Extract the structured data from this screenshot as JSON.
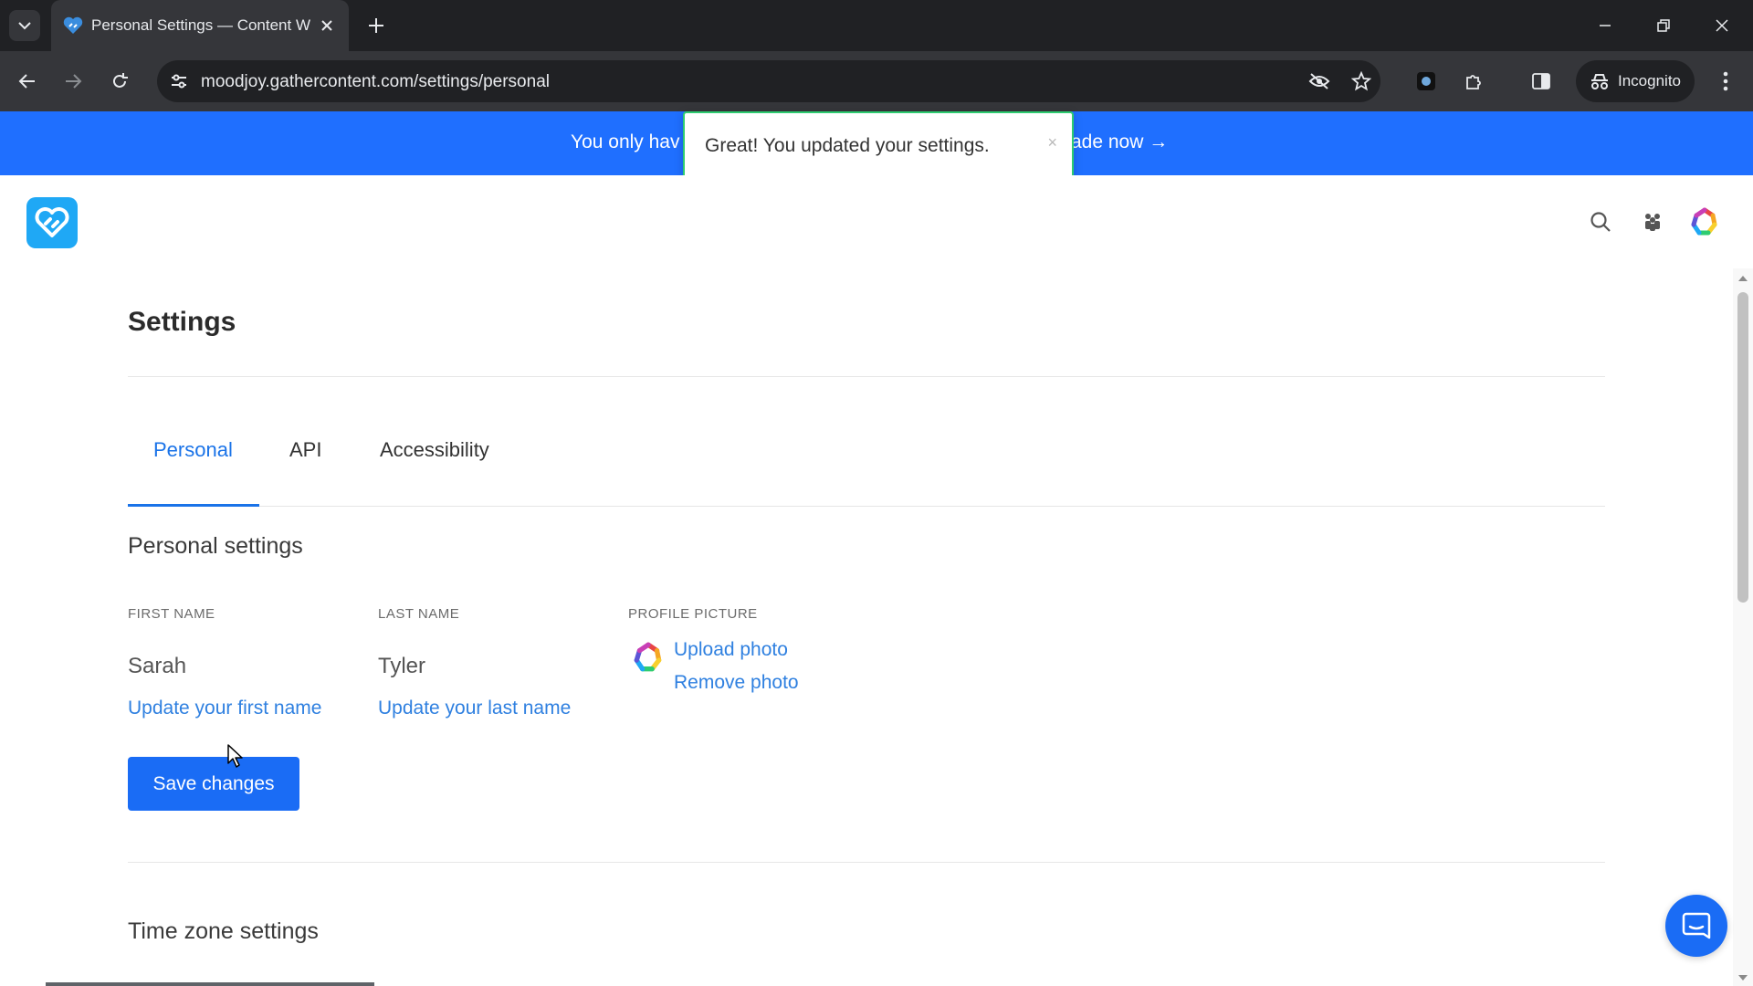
{
  "browser": {
    "tab_title": "Personal Settings — Content W",
    "url": "moodjoy.gathercontent.com/settings/personal",
    "incognito_label": "Incognito"
  },
  "banner": {
    "left_text": "You only hav",
    "right_text": "rade now →",
    "color": "#1f6fff"
  },
  "toast": {
    "message": "Great! You updated your settings.",
    "close": "×"
  },
  "page": {
    "title": "Settings",
    "tabs": [
      {
        "label": "Personal",
        "active": true
      },
      {
        "label": "API",
        "active": false
      },
      {
        "label": "Accessibility",
        "active": false
      }
    ],
    "personal": {
      "heading": "Personal settings",
      "first_name_label": "FIRST NAME",
      "first_name_value": "Sarah",
      "first_name_link": "Update your first name",
      "last_name_label": "LAST NAME",
      "last_name_value": "Tyler",
      "last_name_link": "Update your last name",
      "profile_picture_label": "PROFILE PICTURE",
      "upload_photo": "Upload photo",
      "remove_photo": "Remove photo",
      "save_button": "Save changes"
    },
    "timezone_heading": "Time zone settings"
  },
  "colors": {
    "accent": "#1a6cf5",
    "link": "#2f80e0",
    "toast_border": "#2ecc71"
  }
}
